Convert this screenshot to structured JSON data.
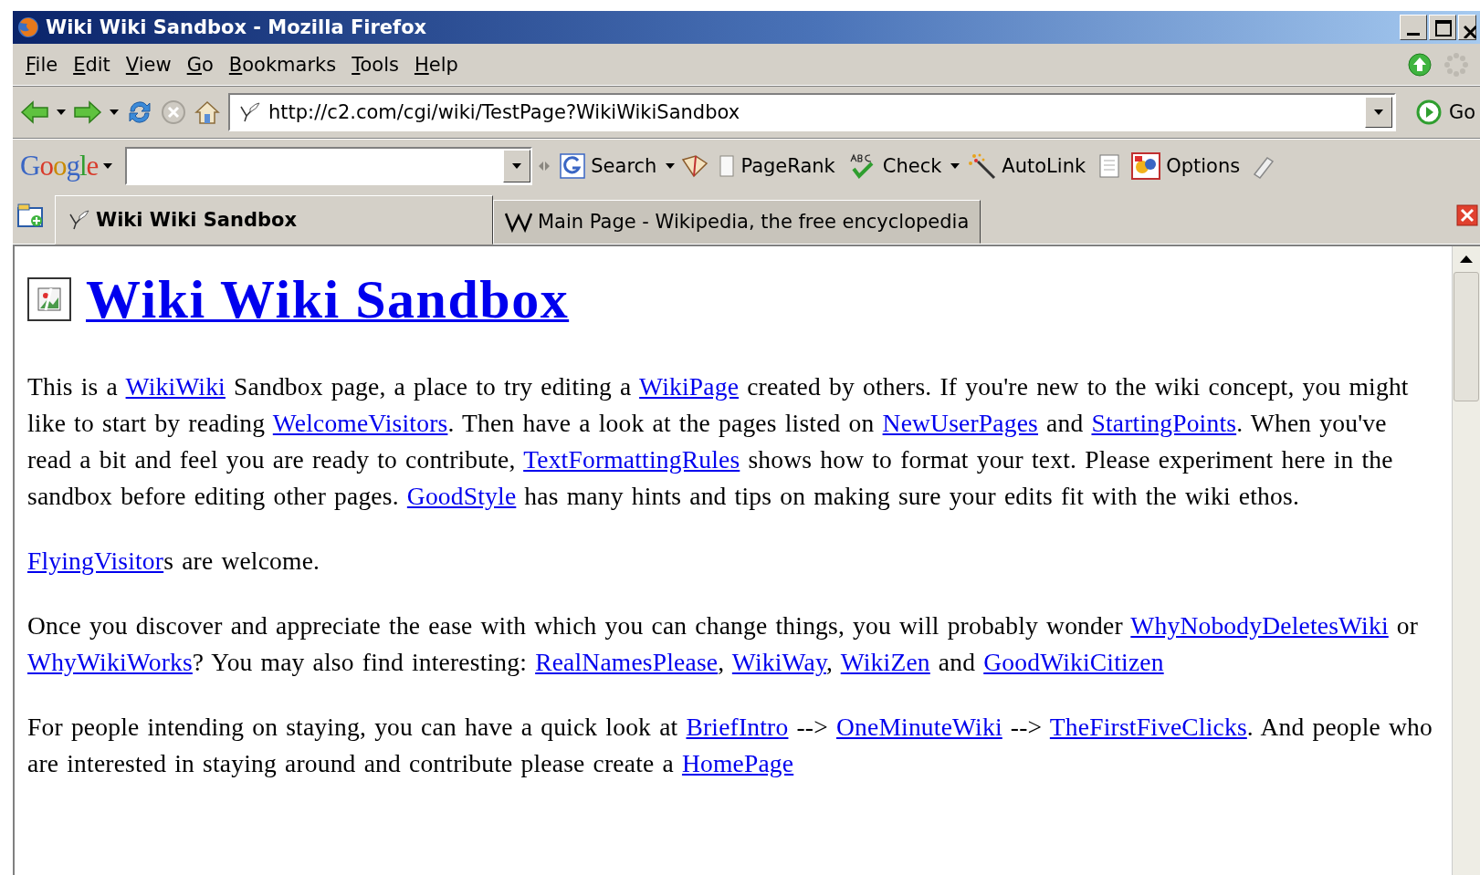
{
  "window": {
    "title": "Wiki Wiki Sandbox - Mozilla Firefox"
  },
  "menu": [
    "File",
    "Edit",
    "View",
    "Go",
    "Bookmarks",
    "Tools",
    "Help"
  ],
  "address": {
    "value": "http://c2.com/cgi/wiki/TestPage?WikiWikiSandbox"
  },
  "go_button": "Go",
  "google_toolbar": {
    "logo": "Google",
    "buttons": [
      {
        "label": "Search",
        "kind": "search"
      },
      {
        "label": "PageRank",
        "kind": "pagerank"
      },
      {
        "label": "Check",
        "kind": "check"
      },
      {
        "label": "AutoLink",
        "kind": "autolink"
      },
      {
        "label": "Options",
        "kind": "options"
      }
    ]
  },
  "tabs": [
    {
      "label": "Wiki Wiki Sandbox",
      "selected": true
    },
    {
      "label": "Main Page - Wikipedia, the free encyclopedia",
      "selected": false
    }
  ],
  "page": {
    "heading": "Wiki Wiki Sandbox",
    "paragraphs": [
      [
        {
          "text": "This is a ",
          "kind": "text"
        },
        {
          "text": "WikiWiki",
          "kind": "link"
        },
        {
          "text": " Sandbox page, a place to try editing a ",
          "kind": "text"
        },
        {
          "text": "WikiPage",
          "kind": "link"
        },
        {
          "text": " created by others. If you're new to the wiki concept, you might like to start by reading ",
          "kind": "text"
        },
        {
          "text": "WelcomeVisitors",
          "kind": "link"
        },
        {
          "text": ". Then have a look at the pages listed on ",
          "kind": "text"
        },
        {
          "text": "NewUserPages",
          "kind": "link"
        },
        {
          "text": " and ",
          "kind": "text"
        },
        {
          "text": "StartingPoints",
          "kind": "link"
        },
        {
          "text": ". When you've read a bit and feel you are ready to contribute, ",
          "kind": "text"
        },
        {
          "text": "TextFormattingRules",
          "kind": "link"
        },
        {
          "text": " shows how to format your text. Please experiment here in the sandbox before editing other pages. ",
          "kind": "text"
        },
        {
          "text": "GoodStyle",
          "kind": "link"
        },
        {
          "text": " has many hints and tips on making sure your edits fit with the wiki ethos.",
          "kind": "text"
        }
      ],
      [
        {
          "text": "FlyingVisitor",
          "kind": "link"
        },
        {
          "text": "s are welcome.",
          "kind": "text"
        }
      ],
      [
        {
          "text": "Once you discover and appreciate the ease with which you can change things, you will probably wonder ",
          "kind": "text"
        },
        {
          "text": "WhyNobodyDeletesWiki",
          "kind": "link"
        },
        {
          "text": " or ",
          "kind": "text"
        },
        {
          "text": "WhyWikiWorks",
          "kind": "link"
        },
        {
          "text": "? You may also find interesting: ",
          "kind": "text"
        },
        {
          "text": "RealNamesPlease",
          "kind": "link"
        },
        {
          "text": ", ",
          "kind": "text"
        },
        {
          "text": "WikiWay",
          "kind": "link"
        },
        {
          "text": ", ",
          "kind": "text"
        },
        {
          "text": "WikiZen",
          "kind": "link"
        },
        {
          "text": " and ",
          "kind": "text"
        },
        {
          "text": "GoodWikiCitizen",
          "kind": "link"
        }
      ],
      [
        {
          "text": "For people intending on staying, you can have a quick look at ",
          "kind": "text"
        },
        {
          "text": "BriefIntro",
          "kind": "link"
        },
        {
          "text": " --> ",
          "kind": "text"
        },
        {
          "text": "OneMinuteWiki",
          "kind": "link"
        },
        {
          "text": " --> ",
          "kind": "text"
        },
        {
          "text": "TheFirstFiveClicks",
          "kind": "link"
        },
        {
          "text": ". And people who are interested in staying around and contribute please create a ",
          "kind": "text"
        },
        {
          "text": "HomePage",
          "kind": "link"
        }
      ]
    ]
  }
}
